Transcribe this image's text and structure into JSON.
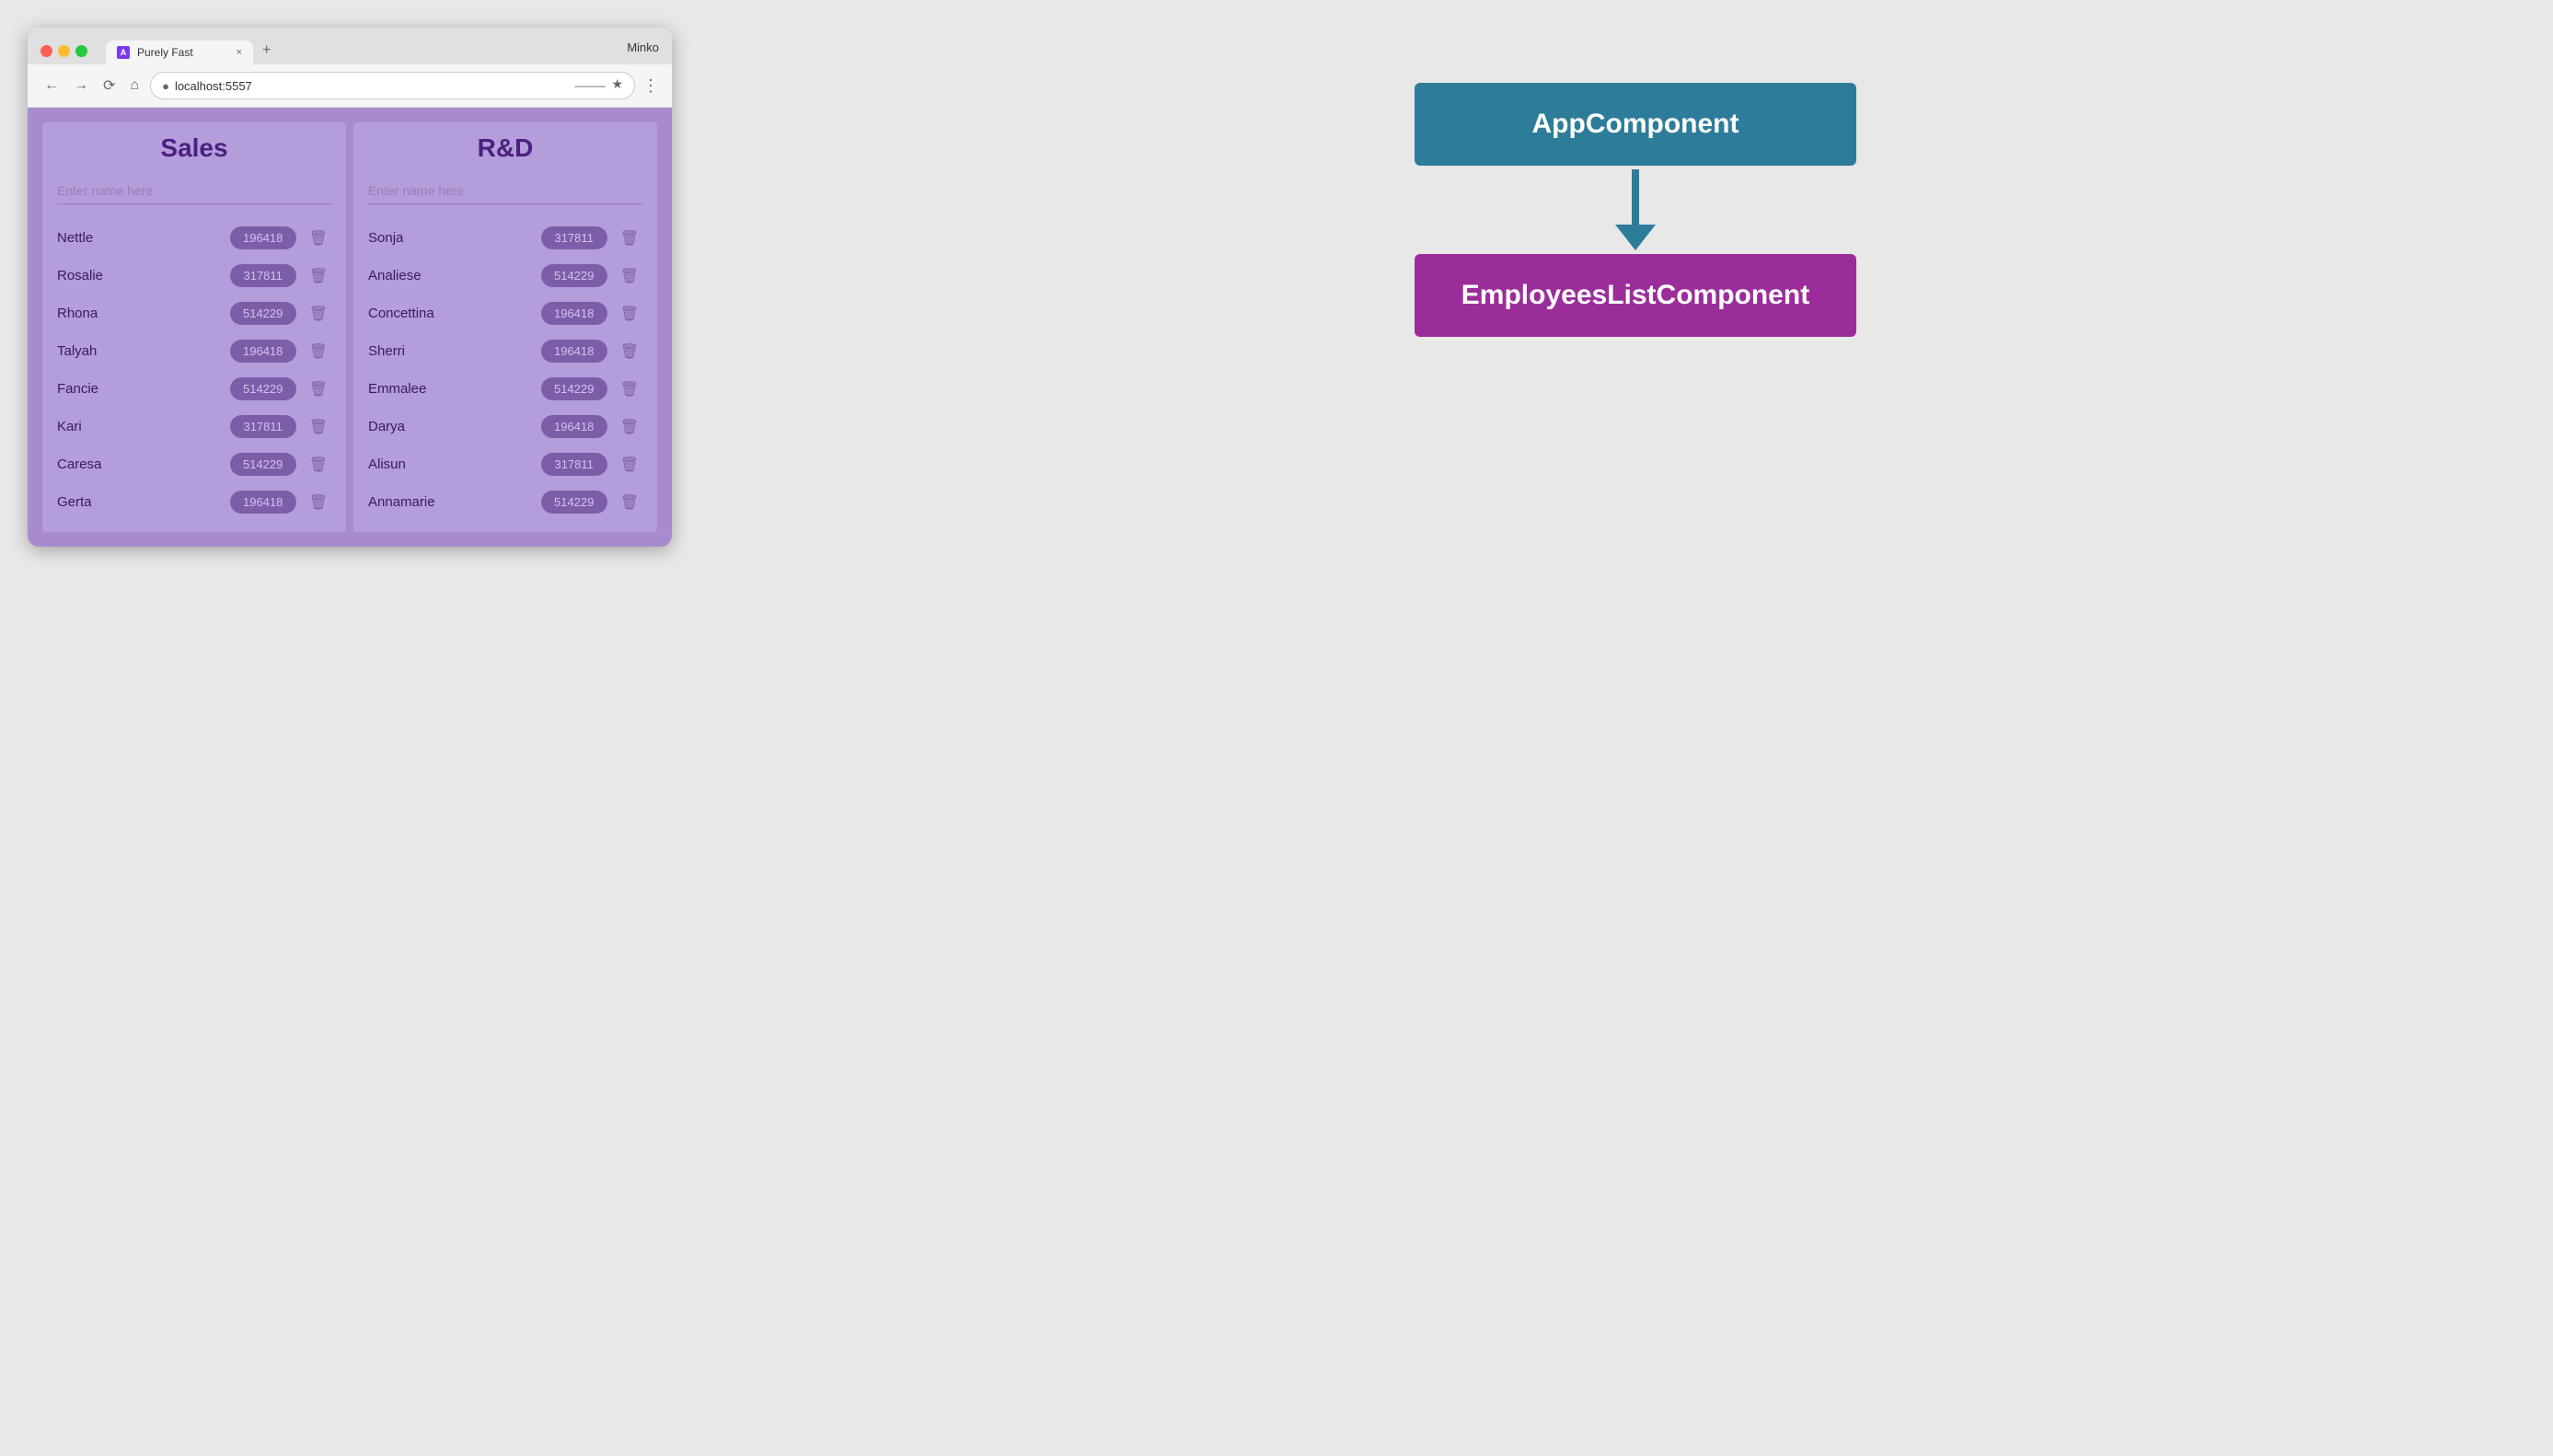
{
  "browser": {
    "tab_title": "Purely Fast",
    "url": "localhost:5557",
    "user_label": "Minko",
    "close_label": "×",
    "new_tab_label": "+"
  },
  "sales": {
    "title": "Sales",
    "placeholder": "Enter name here",
    "employees": [
      {
        "name": "Nettle",
        "badge": "196418"
      },
      {
        "name": "Rosalie",
        "badge": "317811"
      },
      {
        "name": "Rhona",
        "badge": "514229"
      },
      {
        "name": "Talyah",
        "badge": "196418"
      },
      {
        "name": "Fancie",
        "badge": "514229"
      },
      {
        "name": "Kari",
        "badge": "317811"
      },
      {
        "name": "Caresa",
        "badge": "514229"
      },
      {
        "name": "Gerta",
        "badge": "196418"
      }
    ]
  },
  "rd": {
    "title": "R&D",
    "placeholder": "Enter name here",
    "employees": [
      {
        "name": "Sonja",
        "badge": "317811"
      },
      {
        "name": "Analiese",
        "badge": "514229"
      },
      {
        "name": "Concettina",
        "badge": "196418"
      },
      {
        "name": "Sherri",
        "badge": "196418"
      },
      {
        "name": "Emmalee",
        "badge": "514229"
      },
      {
        "name": "Darya",
        "badge": "196418"
      },
      {
        "name": "Alisun",
        "badge": "317811"
      },
      {
        "name": "Annamarie",
        "badge": "514229"
      }
    ]
  },
  "diagram": {
    "app_component_label": "AppComponent",
    "employees_component_label": "EmployeesListComponent"
  },
  "colors": {
    "app_component_bg": "#2d7d9a",
    "employees_component_bg": "#9b2d9b",
    "arrow_color": "#2d7d9a"
  }
}
